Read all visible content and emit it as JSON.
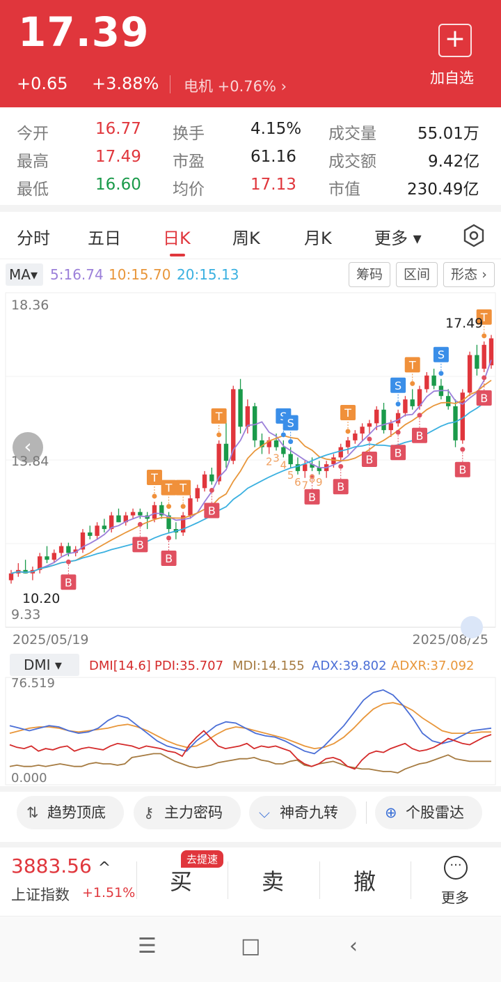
{
  "header": {
    "price": "17.39",
    "change": "+0.65",
    "change_pct": "+3.88%",
    "sector": "电机 +0.76% ›",
    "add_icon": "plus-icon",
    "add_label": "加自选"
  },
  "stats": {
    "open_label": "今开",
    "open": "16.77",
    "high_label": "最高",
    "high": "17.49",
    "low_label": "最低",
    "low": "16.60",
    "turnover_label": "换手",
    "turnover": "4.15%",
    "pe_label": "市盈",
    "pe": "61.16",
    "avg_label": "均价",
    "avg": "17.13",
    "volume_label": "成交量",
    "volume": "55.01万",
    "amount_label": "成交额",
    "amount": "9.42亿",
    "mktcap_label": "市值",
    "mktcap": "230.49亿"
  },
  "tabs": [
    "分时",
    "五日",
    "日K",
    "周K",
    "月K",
    "更多 ▾"
  ],
  "active_tab": "日K",
  "ma": {
    "button": "MA▾",
    "ma5": "5:16.74",
    "ma10": "10:15.70",
    "ma20": "20:15.13",
    "tools": [
      "筹码",
      "区间",
      "形态 ›"
    ]
  },
  "colors": {
    "up": "#e0363c",
    "down": "#1a9a4a",
    "ma5": "#9b7fd9",
    "ma10": "#e8963a",
    "ma20": "#3ab0e0",
    "dmi_pdi": "#d42a2a",
    "dmi_mdi": "#a57a40",
    "dmi_adx": "#4a6ed6",
    "dmi_adxr": "#e8963a"
  },
  "chart_data": {
    "type": "candlestick",
    "y_labels": [
      "18.36",
      "13.84",
      "9.33"
    ],
    "x_labels": [
      "2025/05/19",
      "2025/08/25"
    ],
    "max_label": "17.49",
    "min_label": "10.20",
    "ylim": [
      9.33,
      18.36
    ],
    "candles": [
      [
        10.3,
        10.6,
        10.2,
        10.5
      ],
      [
        10.5,
        10.8,
        10.4,
        10.6
      ],
      [
        10.6,
        10.9,
        10.5,
        10.5
      ],
      [
        10.5,
        10.7,
        10.3,
        10.6
      ],
      [
        10.6,
        11.1,
        10.5,
        11.0
      ],
      [
        11.0,
        11.3,
        10.8,
        10.9
      ],
      [
        10.9,
        11.2,
        10.8,
        11.1
      ],
      [
        11.1,
        11.4,
        11.0,
        11.3
      ],
      [
        11.3,
        11.4,
        11.0,
        11.1
      ],
      [
        11.1,
        11.3,
        11.0,
        11.2
      ],
      [
        11.2,
        11.8,
        11.1,
        11.7
      ],
      [
        11.7,
        11.9,
        11.5,
        11.6
      ],
      [
        11.6,
        12.0,
        11.5,
        11.9
      ],
      [
        11.9,
        12.1,
        11.7,
        11.8
      ],
      [
        11.8,
        12.3,
        11.7,
        12.2
      ],
      [
        12.2,
        12.4,
        12.0,
        12.0
      ],
      [
        12.0,
        12.3,
        11.9,
        12.2
      ],
      [
        12.2,
        12.4,
        12.1,
        12.3
      ],
      [
        12.3,
        12.4,
        12.1,
        12.2
      ],
      [
        12.2,
        12.3,
        11.8,
        12.1
      ],
      [
        12.1,
        12.6,
        12.0,
        12.5
      ],
      [
        12.5,
        12.6,
        12.1,
        12.2
      ],
      [
        12.2,
        12.3,
        11.7,
        11.8
      ],
      [
        11.8,
        12.0,
        11.5,
        11.7
      ],
      [
        11.7,
        12.3,
        11.6,
        12.2
      ],
      [
        12.2,
        12.8,
        12.1,
        12.7
      ],
      [
        12.7,
        13.1,
        12.6,
        13.0
      ],
      [
        13.0,
        13.5,
        12.9,
        13.4
      ],
      [
        13.4,
        13.6,
        13.1,
        13.2
      ],
      [
        13.2,
        14.4,
        13.1,
        14.3
      ],
      [
        14.3,
        15.0,
        13.6,
        13.8
      ],
      [
        13.8,
        16.0,
        13.7,
        15.9
      ],
      [
        15.9,
        16.2,
        14.6,
        14.8
      ],
      [
        14.8,
        15.6,
        14.6,
        15.4
      ],
      [
        15.4,
        15.5,
        14.2,
        14.4
      ],
      [
        14.4,
        14.6,
        14.0,
        14.2
      ],
      [
        14.2,
        14.5,
        14.0,
        14.4
      ],
      [
        14.4,
        14.6,
        14.1,
        14.2
      ],
      [
        14.2,
        14.4,
        13.9,
        14.0
      ],
      [
        14.0,
        14.2,
        13.6,
        13.7
      ],
      [
        13.7,
        13.9,
        13.4,
        13.5
      ],
      [
        13.5,
        13.8,
        13.3,
        13.7
      ],
      [
        13.7,
        13.9,
        13.5,
        13.6
      ],
      [
        13.6,
        13.8,
        13.4,
        13.5
      ],
      [
        13.5,
        13.8,
        13.3,
        13.7
      ],
      [
        13.7,
        14.0,
        13.6,
        13.9
      ],
      [
        13.9,
        14.3,
        13.8,
        14.2
      ],
      [
        14.2,
        14.5,
        14.0,
        14.4
      ],
      [
        14.4,
        14.7,
        14.3,
        14.6
      ],
      [
        14.6,
        14.9,
        14.4,
        14.8
      ],
      [
        14.8,
        15.0,
        14.6,
        14.9
      ],
      [
        14.9,
        15.4,
        14.7,
        15.3
      ],
      [
        15.3,
        15.5,
        14.6,
        14.7
      ],
      [
        14.7,
        15.0,
        14.5,
        14.9
      ],
      [
        14.9,
        15.3,
        14.8,
        15.2
      ],
      [
        15.2,
        15.7,
        15.1,
        15.6
      ],
      [
        15.6,
        15.9,
        15.3,
        15.4
      ],
      [
        15.4,
        16.0,
        15.3,
        15.9
      ],
      [
        15.9,
        16.4,
        15.8,
        16.3
      ],
      [
        16.3,
        16.5,
        15.9,
        16.0
      ],
      [
        16.0,
        16.2,
        15.6,
        15.7
      ],
      [
        15.7,
        15.9,
        15.3,
        15.4
      ],
      [
        15.4,
        15.6,
        14.2,
        14.4
      ],
      [
        14.4,
        15.9,
        14.3,
        15.8
      ],
      [
        15.8,
        17.0,
        15.7,
        16.9
      ],
      [
        16.9,
        17.2,
        16.3,
        16.5
      ],
      [
        16.5,
        17.3,
        16.4,
        17.2
      ],
      [
        16.6,
        17.49,
        16.5,
        17.39
      ]
    ],
    "signals_B": [
      8,
      18,
      22,
      28,
      42,
      46,
      50,
      54,
      57,
      63,
      66
    ],
    "signals_T": [
      20,
      22,
      24,
      29,
      47,
      56,
      66
    ],
    "signals_S": [
      38,
      39,
      54,
      60
    ],
    "nine_count": [
      "2",
      "3",
      "4",
      "5",
      "6",
      "7",
      "8",
      "9"
    ]
  },
  "dmi": {
    "button": "DMI ▾",
    "title": "DMI[14.6]",
    "pdi": "PDI:35.707",
    "mdi": "MDI:14.155",
    "adx": "ADX:39.802",
    "adxr": "ADXR:37.092",
    "ymax": "76.519",
    "ymin": "0.000",
    "pdi_series": [
      27,
      25,
      24,
      26,
      22,
      24,
      23,
      25,
      26,
      22,
      24,
      25,
      24,
      23,
      26,
      28,
      27,
      26,
      24,
      26,
      25,
      24,
      22,
      21,
      18,
      27,
      33,
      38,
      32,
      26,
      24,
      25,
      26,
      28,
      24,
      26,
      25,
      26,
      24,
      22,
      16,
      12,
      10,
      12,
      16,
      17,
      15,
      10,
      8,
      15,
      20,
      22,
      21,
      24,
      26,
      28,
      24,
      22,
      23,
      25,
      28,
      32,
      30,
      28,
      27,
      30,
      33,
      35
    ],
    "mdi_series": [
      10,
      11,
      10,
      10,
      11,
      10,
      11,
      12,
      11,
      10,
      10,
      12,
      13,
      12,
      12,
      11,
      12,
      17,
      18,
      19,
      20,
      20,
      17,
      14,
      12,
      10,
      9,
      10,
      11,
      13,
      14,
      15,
      16,
      16,
      17,
      15,
      14,
      12,
      12,
      14,
      15,
      11,
      10,
      12,
      13,
      14,
      12,
      10,
      9,
      8,
      8,
      7,
      6,
      6,
      5,
      8,
      10,
      12,
      13,
      15,
      17,
      19,
      16,
      15,
      14,
      14,
      14,
      14
    ],
    "adx_series": [
      42,
      40,
      38,
      40,
      42,
      41,
      38,
      36,
      37,
      40,
      46,
      50,
      48,
      42,
      36,
      30,
      26,
      24,
      22,
      30,
      36,
      42,
      45,
      44,
      40,
      36,
      34,
      33,
      30,
      26,
      22,
      20,
      26,
      34,
      42,
      52,
      62,
      68,
      70,
      66,
      58,
      48,
      36,
      30,
      28,
      30,
      34,
      38,
      39,
      40
    ],
    "adxr_series": [
      36,
      38,
      40,
      41,
      41,
      40,
      38,
      37,
      38,
      39,
      40,
      42,
      43,
      41,
      38,
      34,
      30,
      27,
      25,
      26,
      30,
      35,
      39,
      41,
      40,
      38,
      36,
      34,
      32,
      29,
      26,
      24,
      25,
      28,
      33,
      40,
      48,
      55,
      59,
      60,
      58,
      54,
      48,
      43,
      38,
      36,
      36,
      36,
      37,
      37
    ]
  },
  "shortcuts": [
    {
      "icon": "trend-icon",
      "glyph": "⇅",
      "label": "趋势顶底"
    },
    {
      "icon": "key-icon",
      "glyph": "⚷",
      "label": "主力密码"
    },
    {
      "icon": "wave-icon",
      "glyph": "⌵",
      "label": "神奇九转"
    },
    {
      "icon": "radar-icon",
      "glyph": "⊕",
      "label": "个股雷达"
    }
  ],
  "index": {
    "value": "3883.56",
    "arrow": "^",
    "name": "上证指数",
    "pct": "+1.51%"
  },
  "trade": {
    "buy": "买",
    "sell": "卖",
    "cancel": "撤",
    "badge": "去提速",
    "more": "更多",
    "more_icon_glyph": "···"
  },
  "nav": {
    "menu": "☰",
    "home": "□",
    "back": "‹"
  }
}
